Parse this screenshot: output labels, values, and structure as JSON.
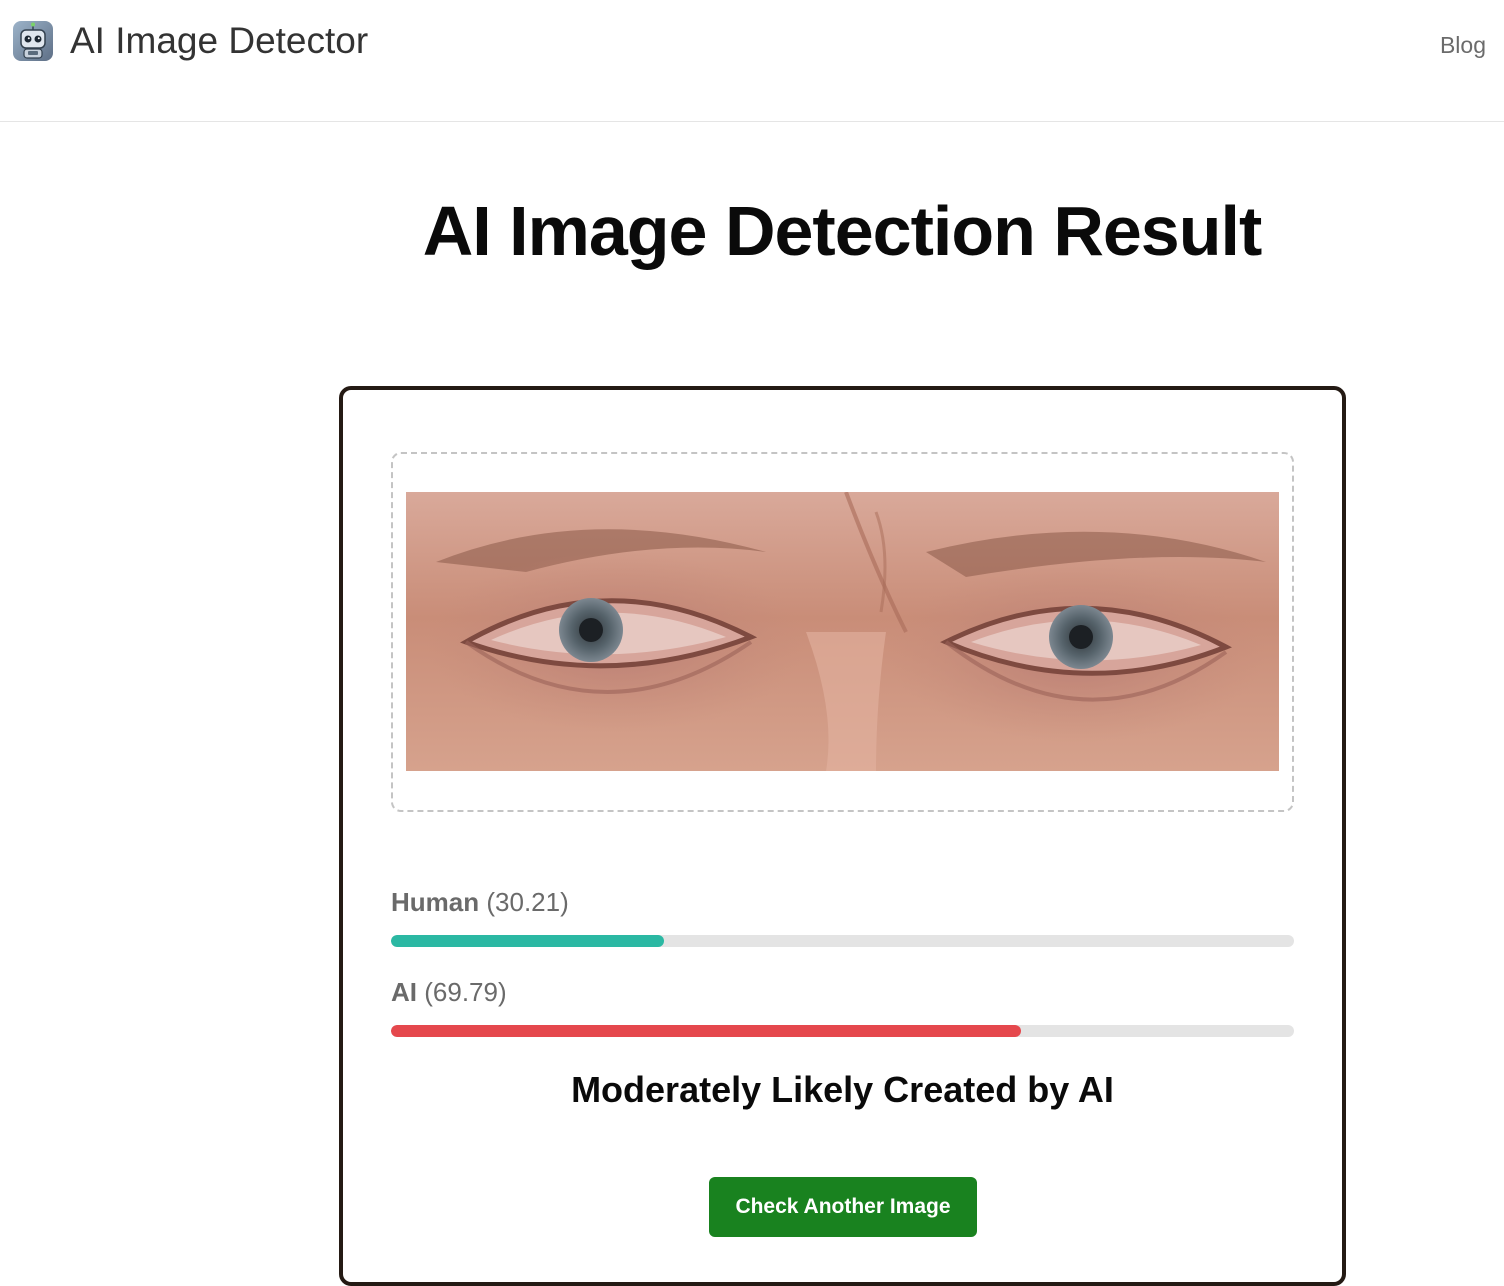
{
  "header": {
    "app_title": "AI Image Detector",
    "logo_icon": "robot-icon",
    "nav": {
      "blog_label": "Blog"
    }
  },
  "page": {
    "title": "AI Image Detection Result"
  },
  "result": {
    "image_alt": "Uploaded image showing close-up of eyes",
    "scores": [
      {
        "name": "Human",
        "value_text": "(30.21)",
        "value": 30.21,
        "color": "#2bb8a3"
      },
      {
        "name": "AI",
        "value_text": "(69.79)",
        "value": 69.79,
        "color": "#e5484d"
      }
    ],
    "verdict": "Moderately Likely Created by AI",
    "action_label": "Check Another Image",
    "action_color": "#19821f"
  }
}
